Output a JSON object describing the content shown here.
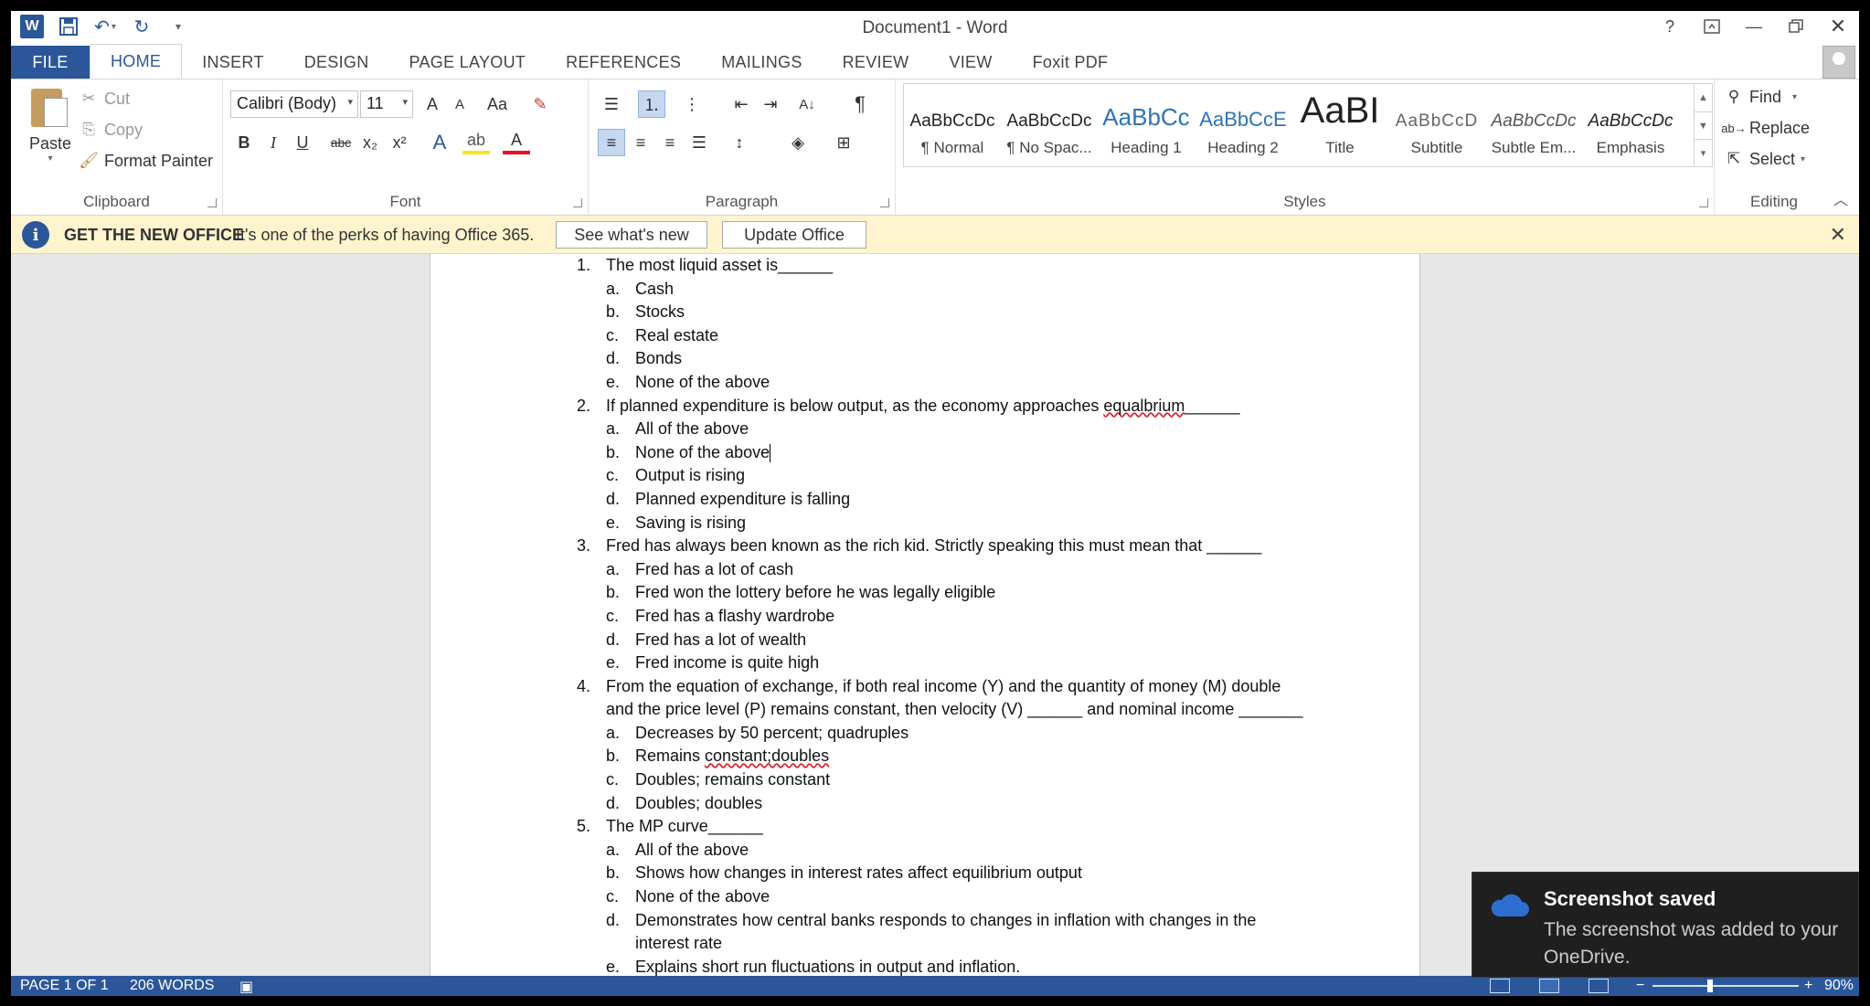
{
  "window": {
    "title": "Document1 - Word"
  },
  "titlebar": {
    "help": "?"
  },
  "tabs": [
    "FILE",
    "HOME",
    "INSERT",
    "DESIGN",
    "PAGE LAYOUT",
    "REFERENCES",
    "MAILINGS",
    "REVIEW",
    "VIEW",
    "Foxit PDF"
  ],
  "active_tab": "HOME",
  "clipboard": {
    "paste": "Paste",
    "cut": "Cut",
    "copy": "Copy",
    "format_painter": "Format Painter",
    "label": "Clipboard"
  },
  "font": {
    "name": "Calibri (Body)",
    "size": "11",
    "label": "Font",
    "grow": "A",
    "shrink": "A",
    "change_case": "Aa",
    "bold": "B",
    "italic": "I",
    "underline": "U",
    "strike": "abc",
    "subscript": "x₂",
    "superscript": "x²",
    "color_letter": "A"
  },
  "paragraph": {
    "label": "Paragraph",
    "pilcrow": "¶"
  },
  "styles": {
    "label": "Styles",
    "items": [
      {
        "sample": "AaBbCcDc",
        "name": "¶ Normal"
      },
      {
        "sample": "AaBbCcDc",
        "name": "¶ No Spac..."
      },
      {
        "sample": "AaBbCc",
        "name": "Heading 1"
      },
      {
        "sample": "AaBbCcE",
        "name": "Heading 2"
      },
      {
        "sample": "AaBI",
        "name": "Title"
      },
      {
        "sample": "AaBbCcD",
        "name": "Subtitle"
      },
      {
        "sample": "AaBbCcDc",
        "name": "Subtle Em..."
      },
      {
        "sample": "AaBbCcDc",
        "name": "Emphasis"
      }
    ]
  },
  "editing": {
    "find": "Find",
    "replace": "Replace",
    "select": "Select",
    "label": "Editing"
  },
  "message_bar": {
    "title": "GET THE NEW OFFICE",
    "text": "It's one of the perks of having Office 365.",
    "button1": "See what's new",
    "button2": "Update Office"
  },
  "document": {
    "questions": [
      {
        "num": "1.",
        "text": "The most liquid asset is______",
        "options": [
          [
            "a.",
            "Cash"
          ],
          [
            "b.",
            "Stocks"
          ],
          [
            "c.",
            "Real estate"
          ],
          [
            "d.",
            "Bonds"
          ],
          [
            "e.",
            "None of the above"
          ]
        ]
      },
      {
        "num": "2.",
        "text_before": "If planned expenditure is below output, as the economy approaches ",
        "text_error": "equalbrium",
        "text_after": "______",
        "options": [
          [
            "a.",
            "All of the above"
          ],
          [
            "b.",
            "None of the above"
          ],
          [
            "c.",
            "Output is rising"
          ],
          [
            "d.",
            "Planned expenditure is falling"
          ],
          [
            "e.",
            "Saving is rising"
          ]
        ]
      },
      {
        "num": "3.",
        "text": "Fred has always been known as the rich kid. Strictly speaking this must mean that ______",
        "options": [
          [
            "a.",
            "Fred has a lot of cash"
          ],
          [
            "b.",
            "Fred won the lottery before he was legally eligible"
          ],
          [
            "c.",
            "Fred has a flashy wardrobe"
          ],
          [
            "d.",
            "Fred has a lot of wealth"
          ],
          [
            "e.",
            "Fred income is quite high"
          ]
        ]
      },
      {
        "num": "4.",
        "text_line1": "From the equation of exchange, if both real income (Y) and the quantity of money (M) double",
        "text_line2": "and the price level (P) remains constant, then velocity (V) ______ and nominal income _______",
        "options": [
          [
            "a.",
            "Decreases by 50 percent; quadruples"
          ],
          [
            "b.",
            "Remains "
          ],
          [
            "c.",
            "Doubles; remains constant"
          ],
          [
            "d.",
            "Doubles; doubles"
          ]
        ],
        "option_b_error": "constant;doubles"
      },
      {
        "num": "5.",
        "text": "The MP curve______",
        "options": [
          [
            "a.",
            "All of the above"
          ],
          [
            "b.",
            "Shows how changes in interest rates affect equilibrium output"
          ],
          [
            "c.",
            "None of the above"
          ],
          [
            "d.",
            "Demonstrates how central banks responds to changes in inflation with changes in the"
          ],
          [
            "e.",
            "Explains short run fluctuations in output and inflation."
          ]
        ],
        "option_d_line2": "interest rate"
      }
    ]
  },
  "toast": {
    "title": "Screenshot saved",
    "body": "The screenshot was added to your OneDrive."
  },
  "status": {
    "page": "PAGE 1 OF 1",
    "words": "206 WORDS",
    "zoom": "90%"
  },
  "colors": {
    "accent": "#2b579a",
    "message_bar": "#fff4ce",
    "toast_bg": "#1f1f1f"
  }
}
